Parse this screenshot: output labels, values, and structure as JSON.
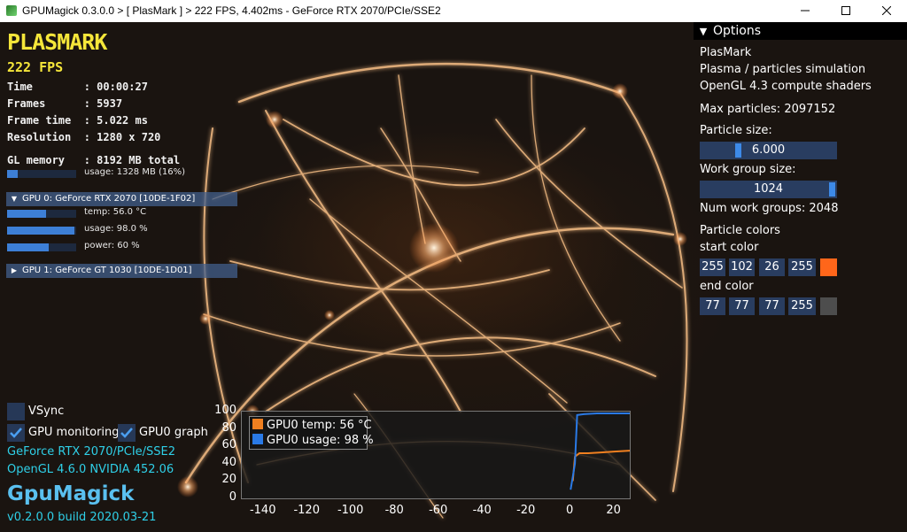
{
  "window": {
    "title": "GPUMagick 0.3.0.0 > [ PlasMark ] > 222 FPS, 4.402ms - GeForce RTX 2070/PCIe/SSE2"
  },
  "overlay": {
    "logo": "PLASMARK",
    "fps": "222 FPS",
    "time": "Time        : 00:00:27",
    "frames": "Frames      : 5937",
    "frame_time": "Frame time  : 5.022 ms",
    "resolution": "Resolution  : 1280 x 720",
    "gl_memory": "GL memory   : 8192 MB total",
    "gl_usage": "usage: 1328 MB (16%)",
    "gl_usage_fraction": 0.16
  },
  "gpus": [
    {
      "header": "GPU 0: GeForce RTX 2070 [10DE-1F02]",
      "expanded": true,
      "temp": "temp: 56.0 °C",
      "temp_fraction": 0.56,
      "usage": "usage: 98.0 %",
      "usage_fraction": 0.98,
      "power": "power: 60 %",
      "power_fraction": 0.6
    },
    {
      "header": "GPU 1: GeForce GT 1030 [10DE-1D01]",
      "expanded": false
    }
  ],
  "controls": {
    "vsync": "VSync",
    "vsync_checked": false,
    "gpu_monitoring": "GPU monitoring",
    "gpu_monitoring_checked": true,
    "gpu0_graph": "GPU0 graph",
    "gpu0_graph_checked": true
  },
  "renderer": {
    "gpu": "GeForce RTX 2070/PCIe/SSE2",
    "opengl": "OpenGL 4.6.0 NVIDIA 452.06",
    "brand": "GpuMagick",
    "version": "v0.2.0.0 build 2020.03-21"
  },
  "options": {
    "header": "Options",
    "line1": "PlasMark",
    "line2": "Plasma / particles simulation",
    "line3": "OpenGL 4.3 compute shaders",
    "max_particles": "Max particles: 2097152",
    "particle_size_label": "Particle size:",
    "particle_size_value": "6.000",
    "work_group_label": "Work group size:",
    "work_group_value": "1024",
    "num_work_groups": "Num work groups: 2048",
    "particle_colors": "Particle colors",
    "start_color_label": "start color",
    "start_color": [
      "255",
      "102",
      "26",
      "255"
    ],
    "start_swatch": "#ff661a",
    "end_color_label": "end color",
    "end_color": [
      "77",
      "77",
      "77",
      "255"
    ],
    "end_swatch": "#4d4d4d"
  },
  "chart_data": {
    "type": "line",
    "x_ticks": [
      "-140",
      "-120",
      "-100",
      "-80",
      "-60",
      "-40",
      "-20",
      "0",
      "20"
    ],
    "y_ticks": [
      "100",
      "80",
      "60",
      "40",
      "20",
      "0"
    ],
    "xlim": [
      -150,
      27
    ],
    "ylim": [
      0,
      100
    ],
    "series": [
      {
        "name": "GPU0 temp: 56 °C",
        "color": "#f08020",
        "points": [
          [
            1,
            20
          ],
          [
            2,
            48
          ],
          [
            4,
            52
          ],
          [
            8,
            52
          ],
          [
            14,
            53
          ],
          [
            20,
            54
          ],
          [
            27,
            55
          ]
        ]
      },
      {
        "name": "GPU0 usage: 98 %",
        "color": "#2a7ae6",
        "points": [
          [
            0,
            10
          ],
          [
            1,
            25
          ],
          [
            2,
            40
          ],
          [
            3,
            96
          ],
          [
            6,
            97
          ],
          [
            12,
            98
          ],
          [
            20,
            98
          ],
          [
            27,
            98
          ]
        ]
      }
    ]
  }
}
